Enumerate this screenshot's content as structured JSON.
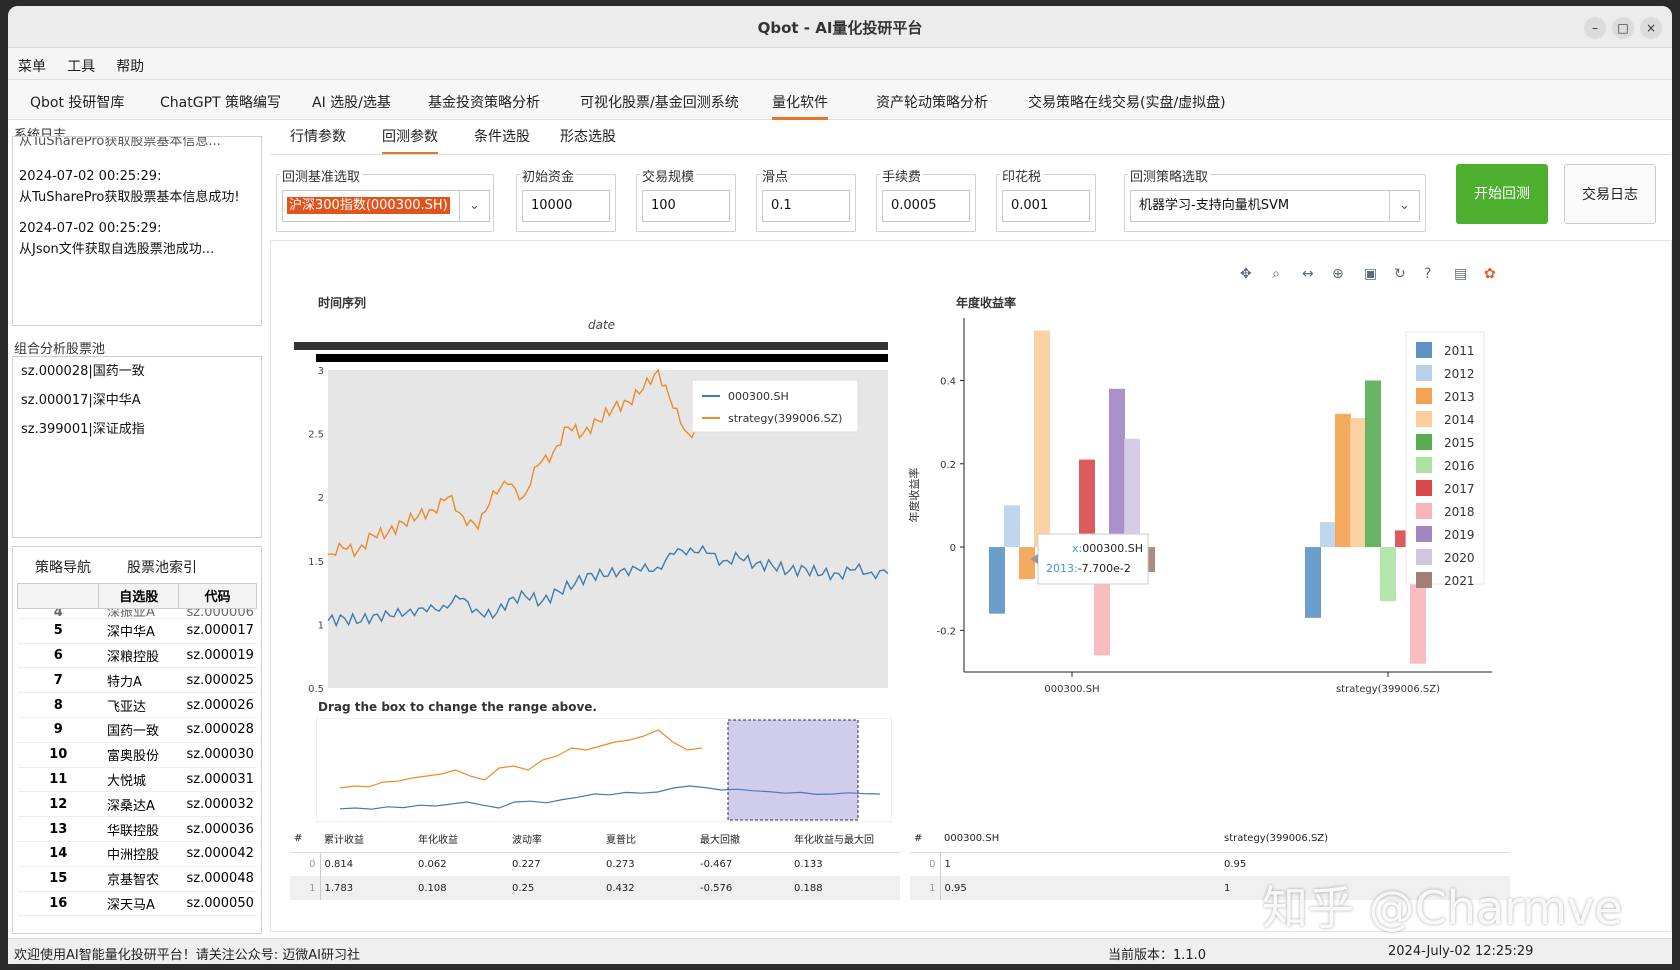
{
  "window": {
    "title": "Qbot - AI量化投研平台"
  },
  "menu": [
    "菜单",
    "工具",
    "帮助"
  ],
  "top_tabs": [
    "Qbot 投研智库",
    "ChatGPT 策略编写",
    "AI 选股/选基",
    "基金投资策略分析",
    "可视化股票/基金回测系统",
    "量化软件",
    "资产轮动策略分析",
    "交易策略在线交易(实盘/虚拟盘)"
  ],
  "system_log": {
    "label": "系统日志",
    "partial": "从TuSharePro获取股票基本信息...",
    "entries": [
      {
        "time": "2024-07-02 00:25:29:",
        "msg": "从TuSharePro获取股票基本信息成功!"
      },
      {
        "time": "2024-07-02 00:25:29:",
        "msg": "从Json文件获取自选股票池成功..."
      }
    ]
  },
  "portfolio_pool": {
    "label": "组合分析股票池",
    "items": [
      "sz.000028|国药一致",
      "sz.000017|深中华A",
      "sz.399001|深证成指"
    ]
  },
  "left_tabs": {
    "nav": "策略导航",
    "index": "股票池索引"
  },
  "stock_table": {
    "headers": [
      "",
      "自选股",
      "代码"
    ],
    "partial_top": {
      "num": "4",
      "name": "深振业A",
      "code": "sz.000006"
    },
    "rows": [
      {
        "num": "5",
        "name": "深中华A",
        "code": "sz.000017"
      },
      {
        "num": "6",
        "name": "深粮控股",
        "code": "sz.000019"
      },
      {
        "num": "7",
        "name": "特力A",
        "code": "sz.000025"
      },
      {
        "num": "8",
        "name": "飞亚达",
        "code": "sz.000026"
      },
      {
        "num": "9",
        "name": "国药一致",
        "code": "sz.000028"
      },
      {
        "num": "10",
        "name": "富奥股份",
        "code": "sz.000030"
      },
      {
        "num": "11",
        "name": "大悦城",
        "code": "sz.000031"
      },
      {
        "num": "12",
        "name": "深桑达A",
        "code": "sz.000032"
      },
      {
        "num": "13",
        "name": "华联控股",
        "code": "sz.000036"
      },
      {
        "num": "14",
        "name": "中洲控股",
        "code": "sz.000042"
      },
      {
        "num": "15",
        "name": "京基智农",
        "code": "sz.000048"
      },
      {
        "num": "16",
        "name": "深天马A",
        "code": "sz.000050"
      }
    ]
  },
  "sub_tabs": [
    "行情参数",
    "回测参数",
    "条件选股",
    "形态选股"
  ],
  "params": {
    "benchmark_label": "回测基准选取",
    "benchmark_value": "沪深300指数(000300.SH)",
    "capital_label": "初始资金",
    "capital_value": "10000",
    "size_label": "交易规模",
    "size_value": "100",
    "slippage_label": "滑点",
    "slippage_value": "0.1",
    "fee_label": "手续费",
    "fee_value": "0.0005",
    "stamp_label": "印花税",
    "stamp_value": "0.001",
    "strategy_label": "回测策略选取",
    "strategy_value": "机器学习-支持向量机SVM"
  },
  "buttons": {
    "start": "开始回测",
    "log": "交易日志"
  },
  "toolbar_icons": [
    "pan-icon",
    "box-zoom-icon",
    "x-zoom-icon",
    "wheel-zoom-icon",
    "save-icon",
    "reset-icon",
    "help-icon",
    "hover-icon",
    "bokeh-logo-icon"
  ],
  "colors": {
    "blue": "#3f7cb0",
    "orange": "#ef8a2a",
    "accent": "#e07a2a",
    "green_btn": "#4caf2e"
  },
  "chart_data": [
    {
      "type": "line",
      "title": "时间序列",
      "xlabel": "date",
      "ylim": [
        0.5,
        3.0
      ],
      "yticks": [
        "0.5",
        "1",
        "1.5",
        "2",
        "2.5",
        "3"
      ],
      "series": [
        {
          "name": "000300.SH",
          "color": "#3f7cb0",
          "values": [
            1.03,
            1.05,
            1.02,
            1.08,
            1.06,
            1.12,
            1.1,
            1.15,
            1.2,
            1.12,
            1.05,
            1.2,
            1.22,
            1.18,
            1.26,
            1.32,
            1.4,
            1.38,
            1.44,
            1.42,
            1.45,
            1.55,
            1.6,
            1.56,
            1.5,
            1.52,
            1.48,
            1.46,
            1.42,
            1.44,
            1.39,
            1.4,
            1.43,
            1.41,
            1.4
          ]
        },
        {
          "name": "strategy(399006.SZ)",
          "color": "#ef8a2a",
          "values": [
            1.55,
            1.6,
            1.58,
            1.7,
            1.72,
            1.8,
            1.85,
            1.9,
            2.0,
            1.85,
            1.75,
            2.05,
            2.1,
            2.0,
            2.25,
            2.35,
            2.55,
            2.5,
            2.6,
            2.7,
            2.75,
            2.85,
            3.0,
            2.7,
            2.5,
            2.55
          ]
        }
      ],
      "range_tip": "Drag the box to change the range above."
    },
    {
      "type": "bar",
      "title": "年度收益率",
      "ylabel": "年度收益率",
      "categories": [
        "000300.SH",
        "strategy(399006.SZ)"
      ],
      "ylim": [
        -0.3,
        0.55
      ],
      "yticks": [
        "-0.2",
        "0",
        "0.2",
        "0.4"
      ],
      "series": [
        {
          "name": "2011",
          "color": "#5b93c4",
          "values": [
            -0.16,
            -0.17
          ]
        },
        {
          "name": "2012",
          "color": "#b9d2ea",
          "values": [
            0.1,
            0.06
          ]
        },
        {
          "name": "2013",
          "color": "#f3a24e",
          "values": [
            -0.077,
            0.32
          ]
        },
        {
          "name": "2014",
          "color": "#fbcd99",
          "values": [
            0.52,
            0.31
          ]
        },
        {
          "name": "2015",
          "color": "#58ad52",
          "values": [
            0.0,
            0.4
          ]
        },
        {
          "name": "2016",
          "color": "#ace2a2",
          "values": [
            0.0,
            -0.13
          ]
        },
        {
          "name": "2017",
          "color": "#d8494a",
          "values": [
            0.21,
            0.04
          ]
        },
        {
          "name": "2018",
          "color": "#f8b5b8",
          "values": [
            -0.26,
            -0.28
          ]
        },
        {
          "name": "2019",
          "color": "#a185c5",
          "values": [
            0.38,
            0.0
          ]
        },
        {
          "name": "2020",
          "color": "#d2c6e3",
          "values": [
            0.26,
            0.0
          ]
        },
        {
          "name": "2021",
          "color": "#a27f76",
          "values": [
            -0.06,
            0.0
          ]
        }
      ],
      "tooltip": {
        "x_label": "x:",
        "x_value": "000300.SH",
        "y_label": "2013:",
        "y_value": "-7.700e-2"
      }
    }
  ],
  "metrics_table": {
    "headers": [
      "#",
      "累计收益",
      "年化收益",
      "波动率",
      "夏普比",
      "最大回撤",
      "年化收益与最大回"
    ],
    "rows": [
      [
        "0",
        "0.814",
        "0.062",
        "0.227",
        "0.273",
        "-0.467",
        "0.133"
      ],
      [
        "1",
        "1.783",
        "0.108",
        "0.25",
        "0.432",
        "-0.576",
        "0.188"
      ]
    ]
  },
  "corr_table": {
    "headers": [
      "#",
      "000300.SH",
      "strategy(399006.SZ)"
    ],
    "rows": [
      [
        "0",
        "1",
        "0.95"
      ],
      [
        "1",
        "0.95",
        "1"
      ]
    ]
  },
  "status": {
    "welcome": "欢迎使用AI智能量化投研平台！请关注公众号: 迈微AI研习社",
    "version": "当前版本：1.1.0",
    "datetime": "2024-July-02 12:25:29"
  },
  "watermark": "知乎 @Charmve"
}
